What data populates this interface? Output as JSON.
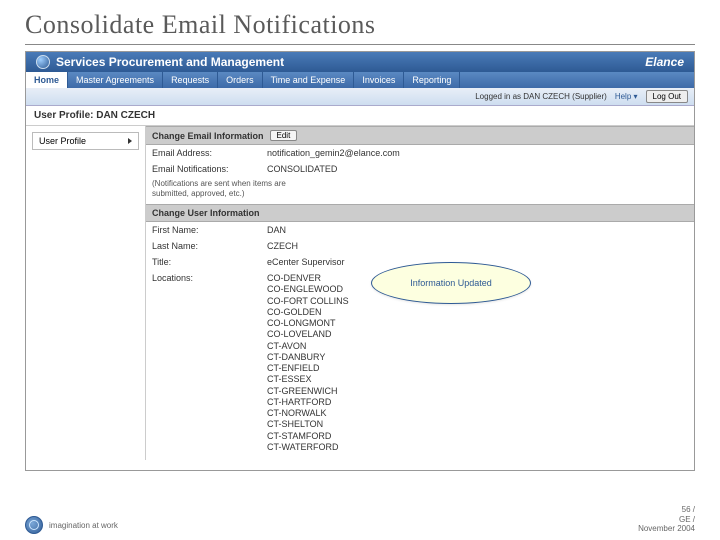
{
  "slide": {
    "title": "Consolidate Email Notifications"
  },
  "app": {
    "header_title": "Services Procurement and Management",
    "header_right": "Elance"
  },
  "nav": {
    "tabs": [
      "Home",
      "Master Agreements",
      "Requests",
      "Orders",
      "Time and Expense",
      "Invoices",
      "Reporting"
    ],
    "active_index": 0
  },
  "subbar": {
    "logged_in": "Logged in as DAN CZECH (Supplier)",
    "help": "Help",
    "logout": "Log Out"
  },
  "profile_bar": "User Profile:  DAN CZECH",
  "left_panel": {
    "item": "User Profile"
  },
  "section_email": {
    "title": "Change Email Information",
    "edit_btn": "Edit",
    "email_label": "Email Address:",
    "email_value": "notification_gemin2@elance.com",
    "notif_label": "Email Notifications:",
    "notif_value": "CONSOLIDATED",
    "note": "(Notifications are sent when items are submitted, approved, etc.)"
  },
  "section_user": {
    "title": "Change User Information",
    "first_name_label": "First Name:",
    "first_name_value": "DAN",
    "last_name_label": "Last Name:",
    "last_name_value": "CZECH",
    "title_label": "Title:",
    "title_value": "eCenter Supervisor",
    "locations_label": "Locations:",
    "locations": [
      "CO-DENVER",
      "CO-ENGLEWOOD",
      "CO-FORT COLLINS",
      "CO-GOLDEN",
      "CO-LONGMONT",
      "CO-LOVELAND",
      "CT-AVON",
      "CT-DANBURY",
      "CT-ENFIELD",
      "CT-ESSEX",
      "CT-GREENWICH",
      "CT-HARTFORD",
      "CT-NORWALK",
      "CT-SHELTON",
      "CT-STAMFORD",
      "CT-WATERFORD"
    ]
  },
  "callout": {
    "text": "Information Updated"
  },
  "footer": {
    "tagline": "imagination at work",
    "page": "56 /",
    "org": "GE /",
    "date": "November 2004"
  }
}
